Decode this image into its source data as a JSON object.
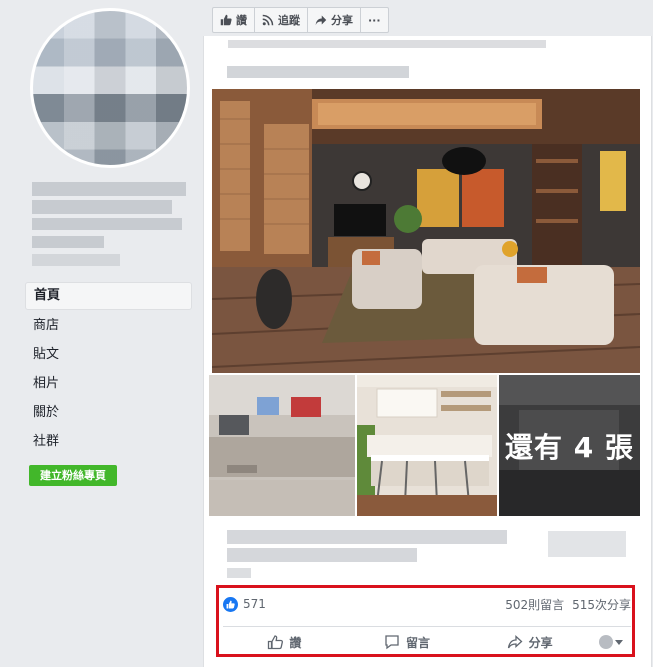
{
  "toolbar": {
    "like_label": "讚",
    "follow_label": "追蹤",
    "share_label": "分享",
    "more_label": "···"
  },
  "sidebar": {
    "items": [
      {
        "label": "首頁",
        "active": true
      },
      {
        "label": "商店"
      },
      {
        "label": "貼文"
      },
      {
        "label": "相片"
      },
      {
        "label": "關於"
      },
      {
        "label": "社群"
      }
    ],
    "create_page_label": "建立粉絲專頁"
  },
  "post": {
    "more_photos_label": "還有 4 張",
    "like_count": "571",
    "comment_count": "502則留言",
    "share_count": "515次分享",
    "actions": {
      "like": "讚",
      "comment": "留言",
      "share": "分享"
    }
  },
  "colors": {
    "background": "#e9ebee",
    "brand_blue": "#1877f2",
    "create_green": "#42b72a",
    "highlight_red": "#d9111c"
  }
}
